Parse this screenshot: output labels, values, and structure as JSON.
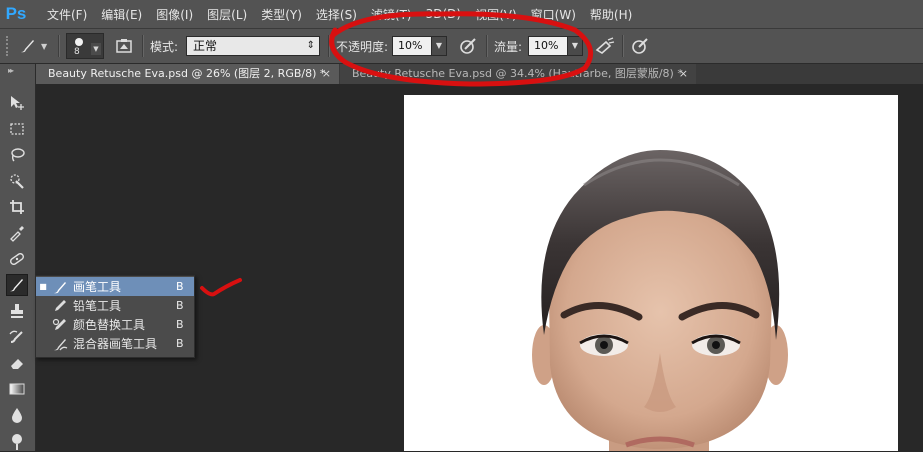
{
  "app": {
    "logo": "Ps"
  },
  "menu": [
    "文件(F)",
    "编辑(E)",
    "图像(I)",
    "图层(L)",
    "类型(Y)",
    "选择(S)",
    "滤镜(T)",
    "3D(D)",
    "视图(V)",
    "窗口(W)",
    "帮助(H)"
  ],
  "options": {
    "brush_size": "8",
    "mode_label": "模式:",
    "mode_value": "正常",
    "opacity_label": "不透明度:",
    "opacity_value": "10%",
    "flow_label": "流量:",
    "flow_value": "10%"
  },
  "tabs": [
    {
      "label": "Beauty Retusche Eva.psd @ 26% (图层 2, RGB/8) *",
      "close": "×"
    },
    {
      "label": "Beauty Retusche Eva.psd @ 34.4% (Hautfarbe, 图层蒙版/8) *",
      "close": "×"
    }
  ],
  "flyout": {
    "items": [
      {
        "name": "画笔工具",
        "key": "B",
        "icon": "brush-icon",
        "selected": true
      },
      {
        "name": "铅笔工具",
        "key": "B",
        "icon": "pencil-icon",
        "selected": false
      },
      {
        "name": "颜色替换工具",
        "key": "B",
        "icon": "color-replace-icon",
        "selected": false
      },
      {
        "name": "混合器画笔工具",
        "key": "B",
        "icon": "mixer-brush-icon",
        "selected": false
      }
    ]
  },
  "colors": {
    "accent": "#31a8ff",
    "annotation": "#d81010",
    "selection": "#6e8fb8"
  }
}
